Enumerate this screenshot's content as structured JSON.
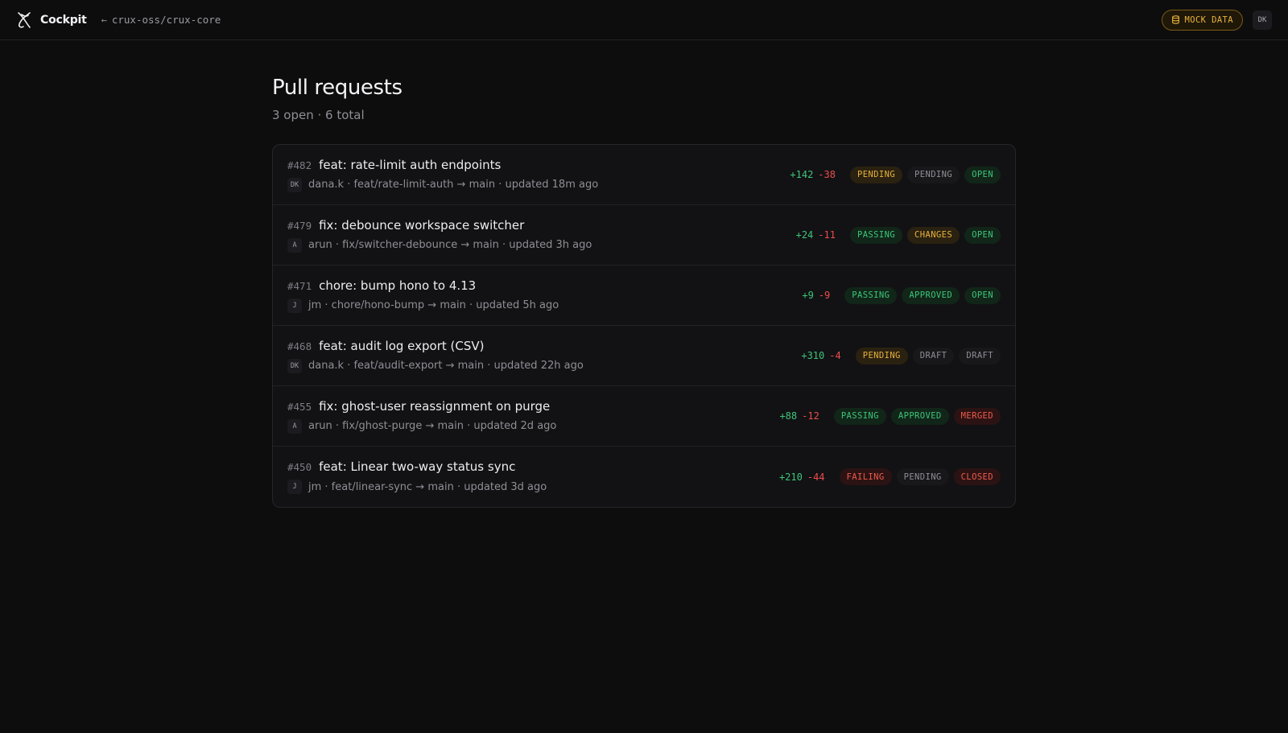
{
  "header": {
    "brand": "Cockpit",
    "back_arrow": "←",
    "repo": "crux-oss/crux-core",
    "mock_badge": "MOCK DATA",
    "user_initials": "DK"
  },
  "page": {
    "title": "Pull requests",
    "subtitle": "3 open · 6 total"
  },
  "colors": {
    "background": "#0d0d0e",
    "additions": "#3ec57a",
    "deletions": "#ee4d4d",
    "warning": "#e8b23d",
    "danger": "#ee5a4d"
  },
  "pull_requests": [
    {
      "number": "#482",
      "title": "feat: rate-limit auth endpoints",
      "avatar": "DK",
      "meta": "dana.k · feat/rate-limit-auth → main · updated 18m ago",
      "additions": "+142",
      "deletions": "-38",
      "ci": {
        "label": "PENDING",
        "tone": "yellow"
      },
      "review": {
        "label": "PENDING",
        "tone": "gray"
      },
      "state": {
        "label": "OPEN",
        "tone": "green"
      }
    },
    {
      "number": "#479",
      "title": "fix: debounce workspace switcher",
      "avatar": "A",
      "meta": "arun · fix/switcher-debounce → main · updated 3h ago",
      "additions": "+24",
      "deletions": "-11",
      "ci": {
        "label": "PASSING",
        "tone": "green"
      },
      "review": {
        "label": "CHANGES",
        "tone": "yellow"
      },
      "state": {
        "label": "OPEN",
        "tone": "green"
      }
    },
    {
      "number": "#471",
      "title": "chore: bump hono to 4.13",
      "avatar": "J",
      "meta": "jm · chore/hono-bump → main · updated 5h ago",
      "additions": "+9",
      "deletions": "-9",
      "ci": {
        "label": "PASSING",
        "tone": "green"
      },
      "review": {
        "label": "APPROVED",
        "tone": "green"
      },
      "state": {
        "label": "OPEN",
        "tone": "green"
      }
    },
    {
      "number": "#468",
      "title": "feat: audit log export (CSV)",
      "avatar": "DK",
      "meta": "dana.k · feat/audit-export → main · updated 22h ago",
      "additions": "+310",
      "deletions": "-4",
      "ci": {
        "label": "PENDING",
        "tone": "yellow"
      },
      "review": {
        "label": "DRAFT",
        "tone": "gray"
      },
      "state": {
        "label": "DRAFT",
        "tone": "gray"
      }
    },
    {
      "number": "#455",
      "title": "fix: ghost-user reassignment on purge",
      "avatar": "A",
      "meta": "arun · fix/ghost-purge → main · updated 2d ago",
      "additions": "+88",
      "deletions": "-12",
      "ci": {
        "label": "PASSING",
        "tone": "green"
      },
      "review": {
        "label": "APPROVED",
        "tone": "green"
      },
      "state": {
        "label": "MERGED",
        "tone": "red"
      }
    },
    {
      "number": "#450",
      "title": "feat: Linear two-way status sync",
      "avatar": "J",
      "meta": "jm · feat/linear-sync → main · updated 3d ago",
      "additions": "+210",
      "deletions": "-44",
      "ci": {
        "label": "FAILING",
        "tone": "red"
      },
      "review": {
        "label": "PENDING",
        "tone": "gray"
      },
      "state": {
        "label": "CLOSED",
        "tone": "red"
      }
    }
  ]
}
